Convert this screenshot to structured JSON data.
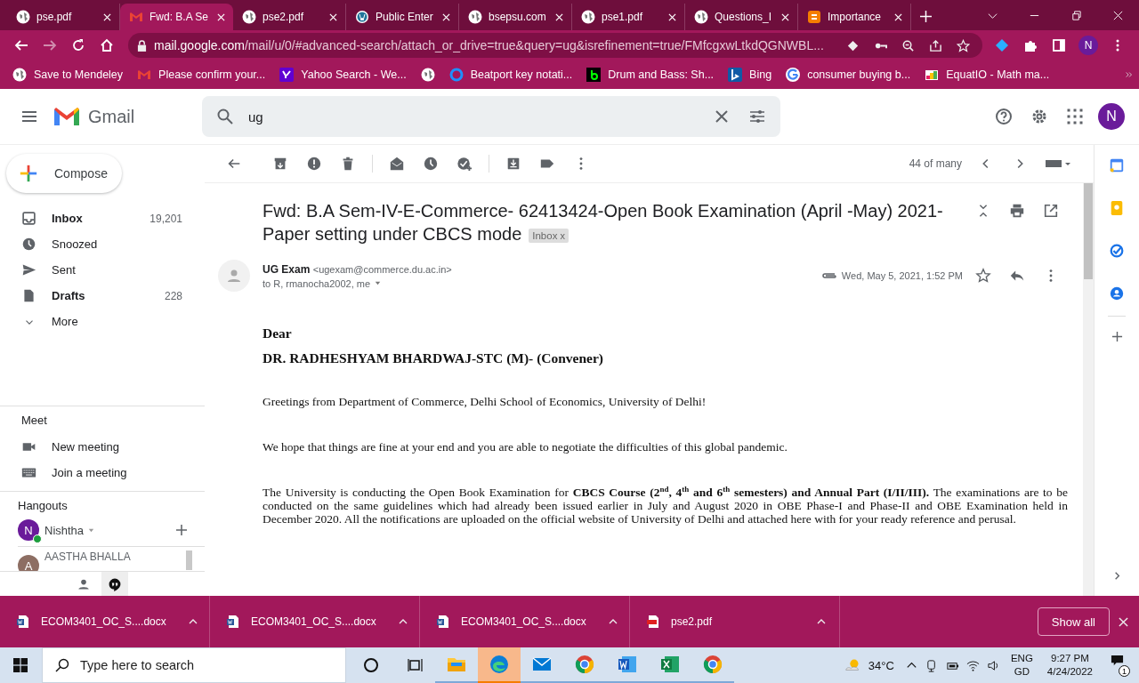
{
  "browser": {
    "tabs": [
      {
        "title": "pse.pdf",
        "kind": "globe",
        "selected": false
      },
      {
        "title": "Fwd: B.A Se",
        "kind": "gmail",
        "selected": true
      },
      {
        "title": "pse2.pdf",
        "kind": "globe",
        "selected": false
      },
      {
        "title": "Public Enter",
        "kind": "wordpress",
        "selected": false
      },
      {
        "title": "bsepsu.com",
        "kind": "globe",
        "selected": false
      },
      {
        "title": "pse1.pdf",
        "kind": "globe",
        "selected": false
      },
      {
        "title": "Questions_I",
        "kind": "globe",
        "selected": false
      },
      {
        "title": "Importance",
        "kind": "blogger",
        "selected": false
      }
    ],
    "url_host": "mail.google.com",
    "url_path": "/mail/u/0/#advanced-search/attach_or_drive=true&query=ug&isrefinement=true/FMfcgxwLtkdQGNWBL...",
    "profile": "N",
    "bookmarks": [
      {
        "label": "Save to Mendeley",
        "kind": "globe"
      },
      {
        "label": "Please confirm your...",
        "kind": "gmail"
      },
      {
        "label": "Yahoo Search - We...",
        "kind": "yahoo"
      },
      {
        "kind": "globe"
      },
      {
        "label": "Beatport key notati...",
        "kind": "ring"
      },
      {
        "label": "Drum and Bass: Sh...",
        "kind": "dark"
      },
      {
        "label": "Bing",
        "kind": "bing"
      },
      {
        "label": "consumer buying b...",
        "kind": "google"
      },
      {
        "label": "EquatIO - Math ma...",
        "kind": "equatio"
      }
    ]
  },
  "gmail": {
    "app_name": "Gmail",
    "search": {
      "value": "ug"
    },
    "profile": "N",
    "compose": "Compose",
    "folders": [
      {
        "label": "Inbox",
        "count": "19,201",
        "kind": "inbox",
        "unread": true
      },
      {
        "label": "Snoozed",
        "kind": "clock",
        "unread": false
      },
      {
        "label": "Sent",
        "kind": "send",
        "unread": false
      },
      {
        "label": "Drafts",
        "count": "228",
        "kind": "draft",
        "unread": true
      },
      {
        "label": "More",
        "kind": "more",
        "unread": false
      }
    ],
    "meet": {
      "heading": "Meet",
      "items": [
        {
          "label": "New meeting",
          "kind": "video"
        },
        {
          "label": "Join a meeting",
          "kind": "keyboard"
        }
      ]
    },
    "hangouts": {
      "heading": "Hangouts",
      "user": {
        "name": "Nishtha",
        "initial": "N"
      },
      "contacts": [
        {
          "name": "AASTHA BHALLA",
          "initial": "A"
        }
      ]
    },
    "counter": "44 of many",
    "email": {
      "subject": "Fwd: B.A Sem-IV-E-Commerce- 62413424-Open Book Examination (April -May) 2021-Paper setting under CBCS mode",
      "label": "Inbox",
      "label_remove": "x",
      "sender": "UG Exam",
      "sender_email": "<ugexam@commerce.du.ac.in>",
      "recipients": "to R, rmanocha2002, me",
      "date": "Wed, May 5, 2021, 1:52 PM",
      "body": [
        {
          "kind": "salutation",
          "text": "Dear"
        },
        {
          "kind": "name",
          "text": "DR. RADHESHYAM BHARDWAJ-STC (M)- (Convener)"
        },
        {
          "kind": "para",
          "text": "Greetings from Department of Commerce, Delhi School of Economics, University of Delhi!"
        },
        {
          "kind": "para",
          "text": "We hope that things are fine at your end and you are able to negotiate the difficulties of this global pandemic."
        },
        {
          "kind": "para",
          "text": "The University is conducting the Open Book Examination for **CBCS Course (2$^{nd}$, 4$^{th}$ and 6$^{th}$ semesters) and Annual Part (I/II/III).** The examinations are to be conducted on the same guidelines which had already been issued earlier in July and August 2020 in OBE Phase-I and Phase-II and OBE Examination held in December 2020. All the notifications are uploaded on the official website of University of Delhi and attached here with for your ready reference and perusal."
        }
      ]
    }
  },
  "downloads": {
    "items": [
      {
        "name": "ECOM3401_OC_S....docx",
        "kind": "word"
      },
      {
        "name": "ECOM3401_OC_S....docx",
        "kind": "word"
      },
      {
        "name": "ECOM3401_OC_S....docx",
        "kind": "word"
      },
      {
        "name": "pse2.pdf",
        "kind": "pdf"
      }
    ],
    "show_all": "Show all"
  },
  "taskbar": {
    "search": {
      "placeholder": "Type here to search"
    },
    "apps": [
      {
        "kind": "explorer",
        "selected": false
      },
      {
        "kind": "edge",
        "selected": true
      },
      {
        "kind": "mail",
        "selected": false
      },
      {
        "kind": "chrome",
        "selected": false
      },
      {
        "kind": "word",
        "selected": false
      },
      {
        "kind": "excel",
        "selected": false
      },
      {
        "kind": "chrome",
        "selected": false
      }
    ],
    "weather": "34°C",
    "lang": "ENG",
    "layout": "GD",
    "time": "9:27 PM",
    "date": "4/24/2022",
    "notifications": "1"
  }
}
